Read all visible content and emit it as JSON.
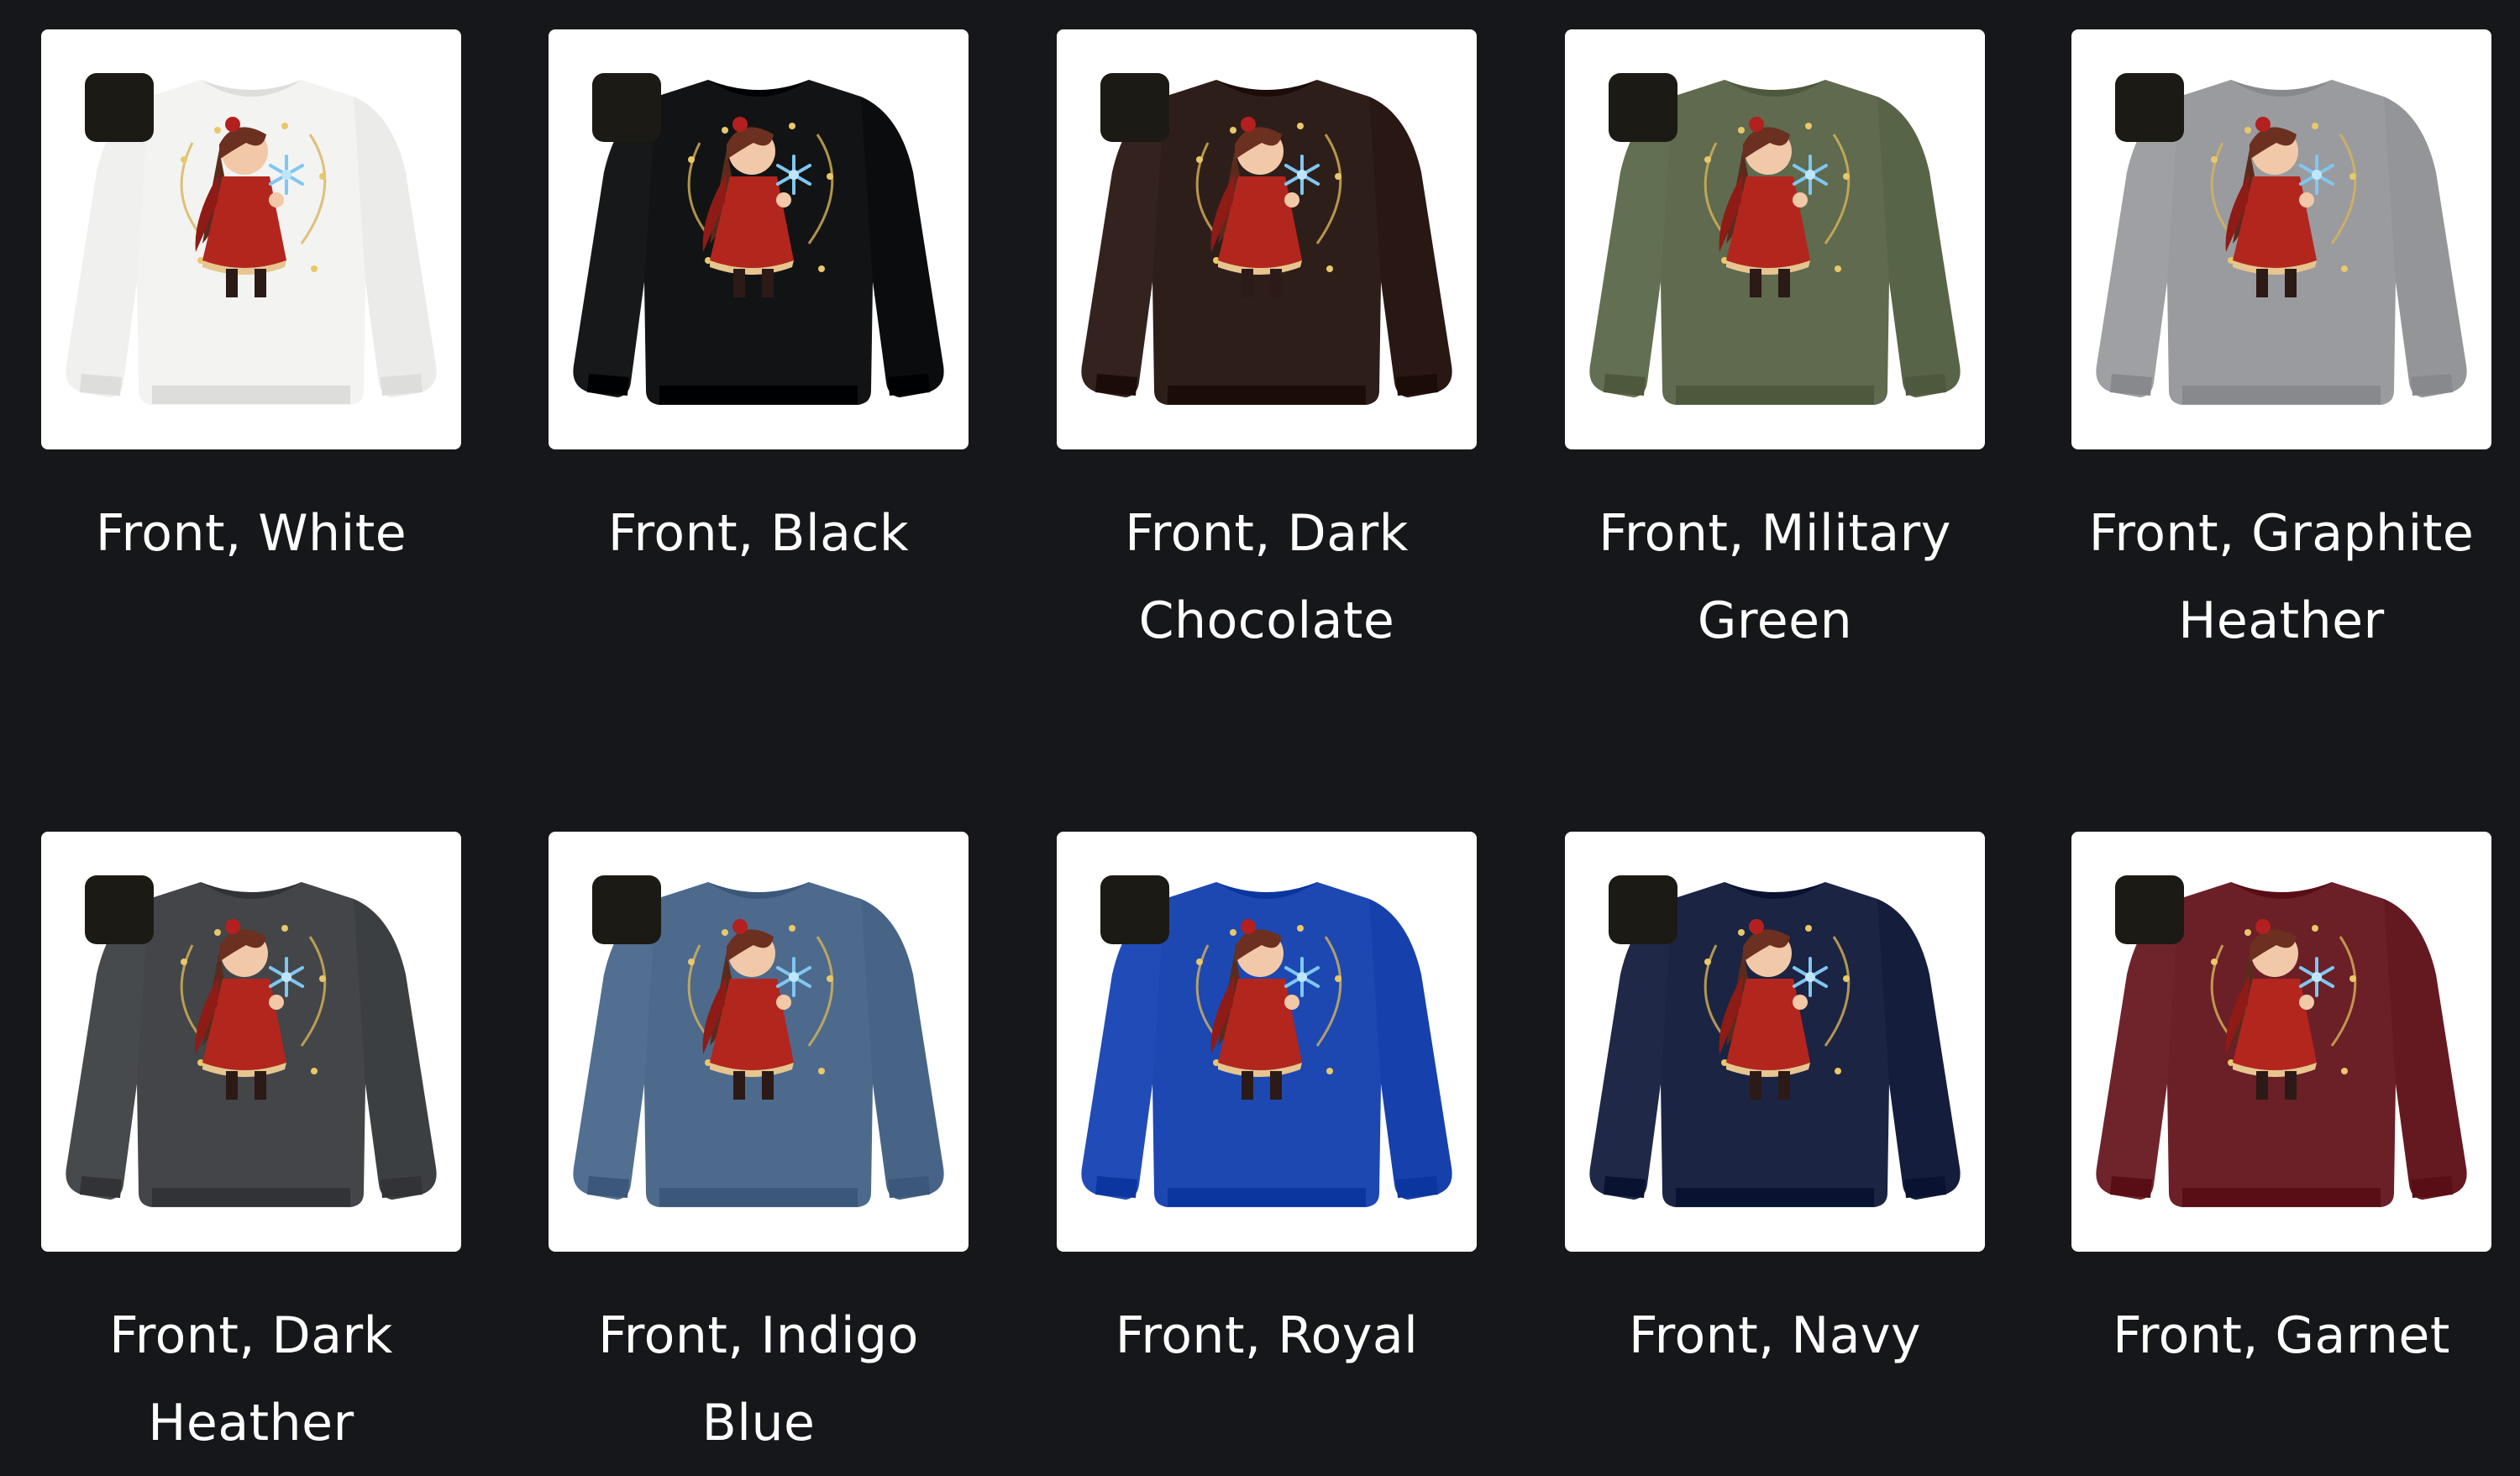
{
  "variants": [
    {
      "label": "Front, White",
      "color": "#f3f3f1"
    },
    {
      "label": "Front, Black",
      "color": "#121314"
    },
    {
      "label": "Front, Dark Chocolate",
      "color": "#2e1e1a"
    },
    {
      "label": "Front, Military Green",
      "color": "#5f6a4e"
    },
    {
      "label": "Front, Graphite Heather",
      "color": "#9a9b9e"
    },
    {
      "label": "Front, Dark Heather",
      "color": "#434548"
    },
    {
      "label": "Front, Indigo Blue",
      "color": "#4d6a8c"
    },
    {
      "label": "Front, Royal",
      "color": "#1d48b2"
    },
    {
      "label": "Front, Navy",
      "color": "#1b2443"
    },
    {
      "label": "Front, Garnet",
      "color": "#6b1f27"
    }
  ]
}
